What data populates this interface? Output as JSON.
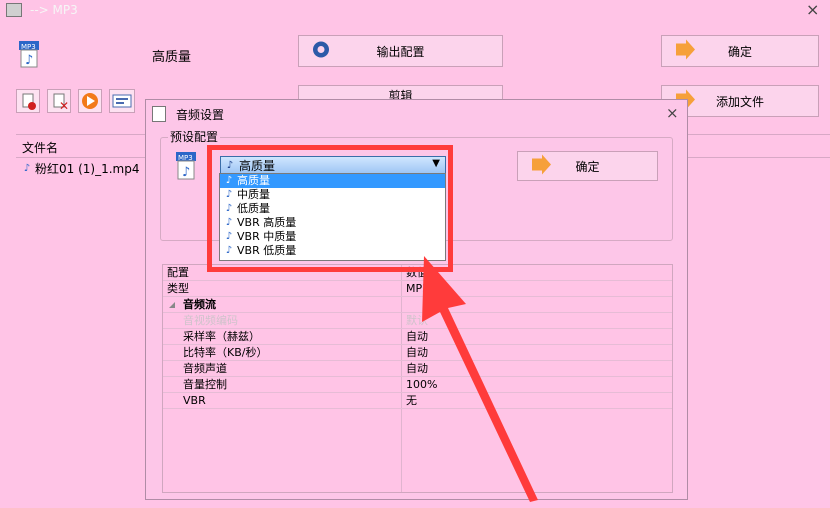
{
  "window": {
    "title": "--> MP3",
    "close_symbol": "×"
  },
  "toolbar": {
    "format_label": "高质量",
    "output_config_label": "输出配置",
    "confirm_label": "确定",
    "add_file_label": "添加文件",
    "edit_label": "剪辑"
  },
  "file_list": {
    "header": "文件名",
    "items": [
      "粉红01 (1)_1.mp4"
    ]
  },
  "dialog": {
    "title": "音频设置",
    "close_symbol": "×",
    "group_label": "预设配置",
    "preset_selected": "高质量",
    "confirm_label": "确定",
    "dropdown_options": [
      "高质量",
      "中质量",
      "低质量",
      "VBR 高质量",
      "VBR 中质量",
      "VBR 低质量"
    ],
    "grid": {
      "col_header_1": "配置",
      "col_header_2": "数值",
      "type_label": "类型",
      "type_value": "MP3",
      "section_label": "音频流",
      "rows": [
        {
          "label": "音视频编码",
          "value": "默认"
        },
        {
          "label": "采样率（赫兹）",
          "value": "自动"
        },
        {
          "label": "比特率（KB/秒）",
          "value": "自动"
        },
        {
          "label": "音频声道",
          "value": "自动"
        },
        {
          "label": "音量控制",
          "value": "100%"
        },
        {
          "label": "VBR",
          "value": "无"
        }
      ]
    }
  },
  "colors": {
    "background": "#ffc4e6",
    "highlight": "#3399ff",
    "annotation": "#ff3b3b"
  }
}
